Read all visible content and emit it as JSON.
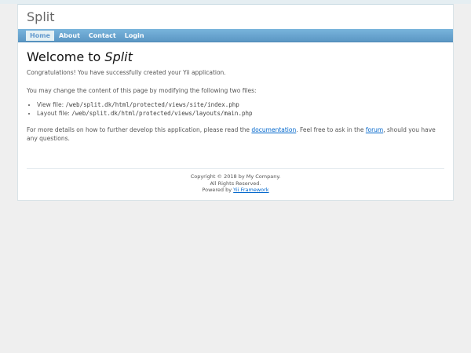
{
  "header": {
    "logo_text": "Split"
  },
  "mainmenu": {
    "items": [
      {
        "label": "Home",
        "active": true
      },
      {
        "label": "About"
      },
      {
        "label": "Contact"
      },
      {
        "label": "Login"
      }
    ]
  },
  "content": {
    "title_prefix": "Welcome to ",
    "title_app": "Split",
    "congrats": "Congratulations! You have successfully created your Yii application.",
    "change_intro": "You may change the content of this page by modifying the following two files:",
    "view_file_label": "View file: ",
    "view_file_path": "/web/split.dk/html/protected/views/site/index.php",
    "layout_file_label": "Layout file: ",
    "layout_file_path": "/web/split.dk/html/protected/views/layouts/main.php",
    "details_prefix": "For more details on how to further develop this application, please read the ",
    "documentation_link": "documentation",
    "details_middle": ". Feel free to ask in the ",
    "forum_link": "forum",
    "details_suffix": ", should you have any questions."
  },
  "footer": {
    "copyright": "Copyright © 2018 by My Company.",
    "rights": "All Rights Reserved.",
    "powered_prefix": "Powered by ",
    "powered_link": "Yii Framework"
  }
}
